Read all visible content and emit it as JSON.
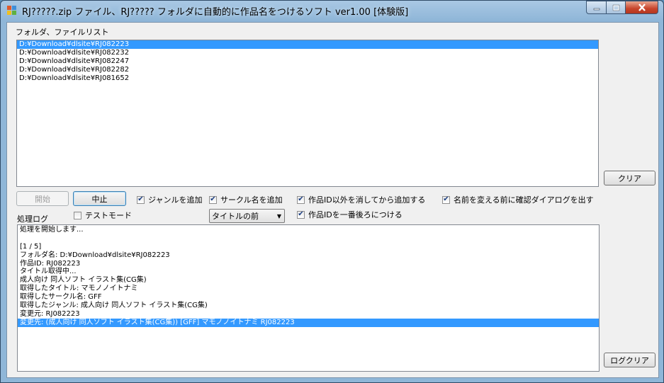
{
  "window": {
    "title": "RJ?????.zip ファイル、RJ????? フォルダに自動的に作品名をつけるソフト ver1.00 [体験版]",
    "colors": {
      "title_gradient": "#a9c8e4",
      "selection": "#3399ff",
      "close_button": "#c7442b"
    }
  },
  "caption_buttons": {
    "minimize_icon": "minimize-icon",
    "maximize_icon": "maximize-icon",
    "close_icon": "close-icon"
  },
  "file_list": {
    "label": "フォルダ、ファイルリスト",
    "items": [
      "D:¥Download¥dlsite¥RJ082223",
      "D:¥Download¥dlsite¥RJ082232",
      "D:¥Download¥dlsite¥RJ082247",
      "D:¥Download¥dlsite¥RJ082282",
      "D:¥Download¥dlsite¥RJ081652"
    ],
    "selected_index": 0
  },
  "buttons": {
    "clear": "クリア",
    "start": "開始",
    "stop": "中止",
    "log_clear": "ログクリア"
  },
  "options": {
    "add_genre": {
      "label": "ジャンルを追加",
      "checked": true
    },
    "add_circle": {
      "label": "サークル名を追加",
      "checked": true
    },
    "erase_except_id": {
      "label": "作品ID以外を消してから追加する",
      "checked": true
    },
    "confirm_dialog": {
      "label": "名前を変える前に確認ダイアログを出す",
      "checked": true
    },
    "test_mode": {
      "label": "テストモード",
      "checked": false
    },
    "id_last": {
      "label": "作品IDを一番後ろにつける",
      "checked": true
    },
    "position_select": {
      "value": "タイトルの前"
    }
  },
  "log": {
    "label": "処理ログ",
    "lines": [
      "処理を開始します...",
      "",
      "[1 / 5]",
      "フォルダ名: D:¥Download¥dlsite¥RJ082223",
      "作品ID: RJ082223",
      "タイトル取得中...",
      "成人向け 同人ソフト イラスト集(CG集)",
      "取得したタイトル: マモノノイトナミ",
      "取得したサークル名: GFF",
      "取得したジャンル: 成人向け 同人ソフト イラスト集(CG集)",
      "変更元: RJ082223",
      "変更先: (成人向け 同人ソフト イラスト集(CG集)) [GFF] マモノノイトナミ RJ082223"
    ],
    "selected_index": 11
  }
}
